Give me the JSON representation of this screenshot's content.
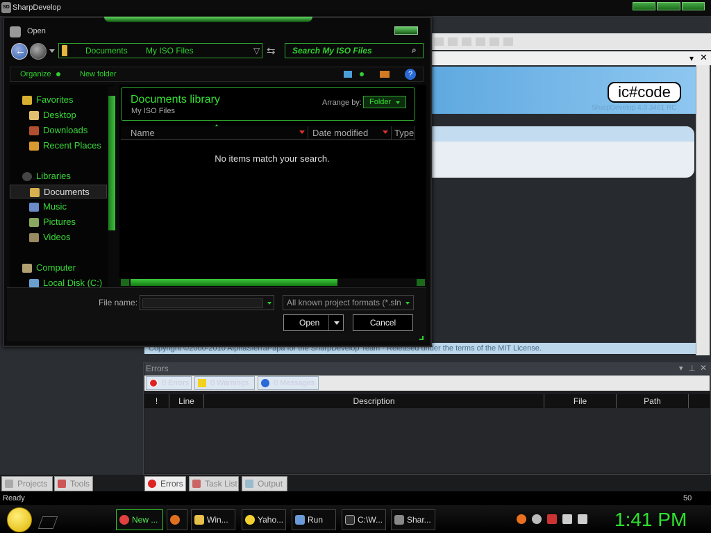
{
  "app": {
    "title": "SharpDevelop"
  },
  "start_page": {
    "logo": "ic#code",
    "version_text": "SharpDevelop 4.0.3461 RC",
    "copyright": "Copyright ©2000-2010 AlphaSierraPapa for the SharpDevelop Team · Released under the terms of the MIT License."
  },
  "errors_pad": {
    "title": "Errors",
    "filters": {
      "errors": "0 Errors",
      "warnings": "0 Warnings",
      "messages": "0 Messages"
    },
    "columns": [
      "!",
      "Line",
      "Description",
      "File",
      "Path"
    ]
  },
  "bottom_tabs": {
    "left": [
      "Projects",
      "Tools"
    ],
    "right": [
      "Errors",
      "Task List",
      "Output"
    ]
  },
  "status_bar": {
    "left": "Ready",
    "right": "50"
  },
  "dialog": {
    "title": "Open",
    "address": {
      "crumb1": "Documents",
      "crumb2": "My ISO Files"
    },
    "search_placeholder": "Search My ISO Files",
    "command_bar": {
      "organize": "Organize",
      "new_folder": "New folder"
    },
    "nav": {
      "favorites": "Favorites",
      "desktop": "Desktop",
      "downloads": "Downloads",
      "recent": "Recent Places",
      "libraries": "Libraries",
      "documents": "Documents",
      "music": "Music",
      "pictures": "Pictures",
      "videos": "Videos",
      "computer": "Computer",
      "local_disk": "Local Disk (C:)"
    },
    "library_title": "Documents library",
    "library_sub": "My ISO Files",
    "arrange_label": "Arrange by:",
    "arrange_value": "Folder",
    "columns": {
      "name": "Name",
      "date": "Date modified",
      "type": "Type"
    },
    "empty_message": "No items match your search.",
    "file_name_label": "File name:",
    "file_name_value": "",
    "file_type": "All known project formats (*.sln",
    "open_label": "Open",
    "cancel_label": "Cancel"
  },
  "taskbar": {
    "items": [
      "New ...",
      "Win...",
      "Yaho...",
      "Run",
      "C:\\W...",
      "Shar..."
    ],
    "clock": "1:41 PM"
  },
  "colors": {
    "accent": "#2ed02e",
    "dialog_bg": "#0a0a0a",
    "banner": "#6bb3e6"
  }
}
